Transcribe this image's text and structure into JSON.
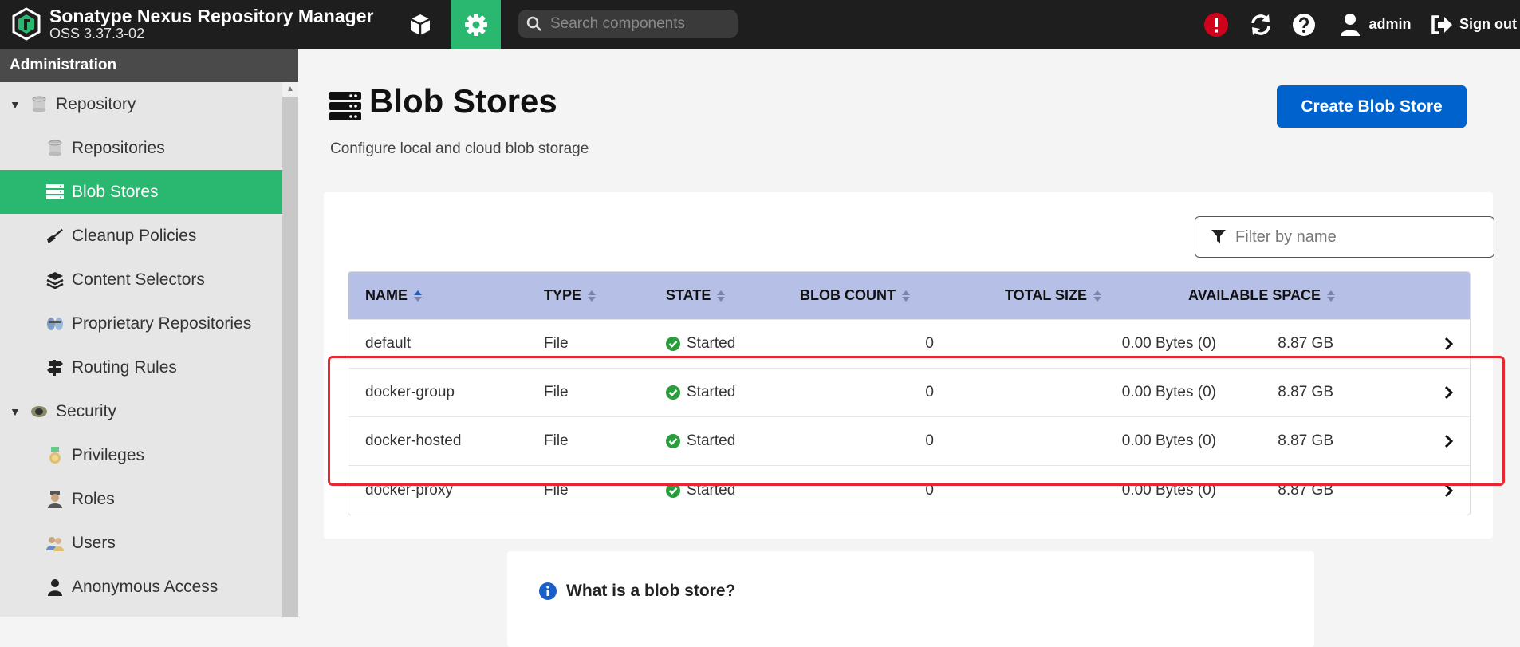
{
  "header": {
    "title": "Sonatype Nexus Repository Manager",
    "version": "OSS 3.37.3-02",
    "search_placeholder": "Search components",
    "user_label": "admin",
    "signout_label": "Sign out",
    "accent_color": "#2ab871"
  },
  "sidebar": {
    "heading": "Administration",
    "items": [
      {
        "label": "Repository",
        "level": 0,
        "icon": "database-icon",
        "expanded": true
      },
      {
        "label": "Repositories",
        "level": 1,
        "icon": "database-icon"
      },
      {
        "label": "Blob Stores",
        "level": 1,
        "icon": "server-icon",
        "active": true
      },
      {
        "label": "Cleanup Policies",
        "level": 1,
        "icon": "broom-icon"
      },
      {
        "label": "Content Selectors",
        "level": 1,
        "icon": "layers-icon"
      },
      {
        "label": "Proprietary Repositories",
        "level": 1,
        "icon": "proprietary-icon"
      },
      {
        "label": "Routing Rules",
        "level": 1,
        "icon": "signpost-icon"
      },
      {
        "label": "Security",
        "level": 0,
        "icon": "security-icon",
        "expanded": true
      },
      {
        "label": "Privileges",
        "level": 1,
        "icon": "medal-icon"
      },
      {
        "label": "Roles",
        "level": 1,
        "icon": "role-icon"
      },
      {
        "label": "Users",
        "level": 1,
        "icon": "users-icon"
      },
      {
        "label": "Anonymous Access",
        "level": 1,
        "icon": "user-icon"
      }
    ]
  },
  "main": {
    "title": "Blob Stores",
    "subtitle": "Configure local and cloud blob storage",
    "create_label": "Create Blob Store",
    "filter_placeholder": "Filter by name",
    "columns": [
      "NAME",
      "TYPE",
      "STATE",
      "BLOB COUNT",
      "TOTAL SIZE",
      "AVAILABLE SPACE"
    ],
    "rows": [
      {
        "name": "default",
        "type": "File",
        "state": "Started",
        "blob_count": "0",
        "total_size": "0.00 Bytes (0)",
        "available_space": "8.87 GB"
      },
      {
        "name": "docker-group",
        "type": "File",
        "state": "Started",
        "blob_count": "0",
        "total_size": "0.00 Bytes (0)",
        "available_space": "8.87 GB"
      },
      {
        "name": "docker-hosted",
        "type": "File",
        "state": "Started",
        "blob_count": "0",
        "total_size": "0.00 Bytes (0)",
        "available_space": "8.87 GB"
      },
      {
        "name": "docker-proxy",
        "type": "File",
        "state": "Started",
        "blob_count": "0",
        "total_size": "0.00 Bytes (0)",
        "available_space": "8.87 GB"
      }
    ],
    "info_title": "What is a blob store?",
    "highlight_color": "#e8262e"
  }
}
